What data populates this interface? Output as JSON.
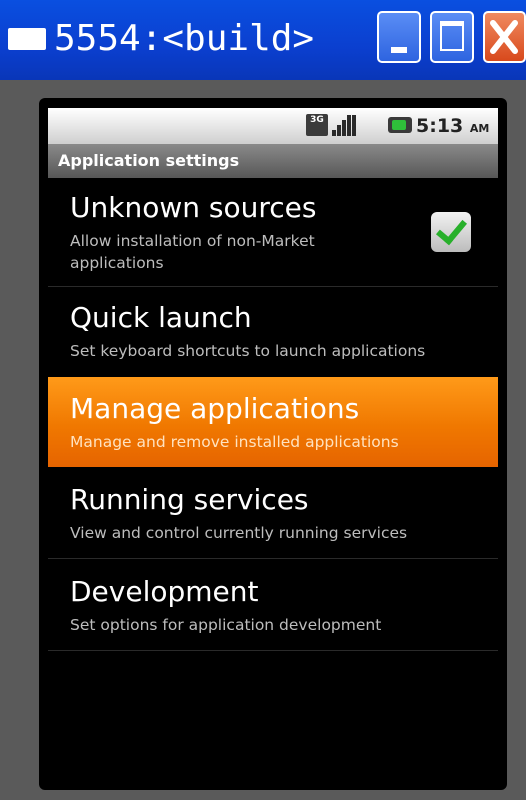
{
  "window": {
    "title": "5554:<build>",
    "buttons": {
      "minimize": "minimize-icon",
      "maximize": "maximize-icon",
      "close": "close-icon"
    }
  },
  "status_bar": {
    "network_badge": "3G",
    "time": "5:13",
    "ampm": "AM",
    "icons": [
      "3g-icon",
      "signal-icon",
      "battery-icon"
    ]
  },
  "screen": {
    "title": "Application settings"
  },
  "settings": [
    {
      "title": "Unknown sources",
      "summary_line1": "Allow installation of non-Market",
      "summary_line2": "applications",
      "checked": true
    },
    {
      "title": "Quick launch",
      "summary": "Set keyboard shortcuts to launch applications"
    },
    {
      "title": "Manage applications",
      "summary": "Manage and remove installed applications",
      "highlighted": true
    },
    {
      "title": "Running services",
      "summary": "View and control currently running services"
    },
    {
      "title": "Development",
      "summary": "Set options for application development"
    }
  ],
  "colors": {
    "titlebar": "#0b3fcf",
    "highlight": "#f07800",
    "checkmark": "#28b02b",
    "screen_background": "#000000"
  }
}
